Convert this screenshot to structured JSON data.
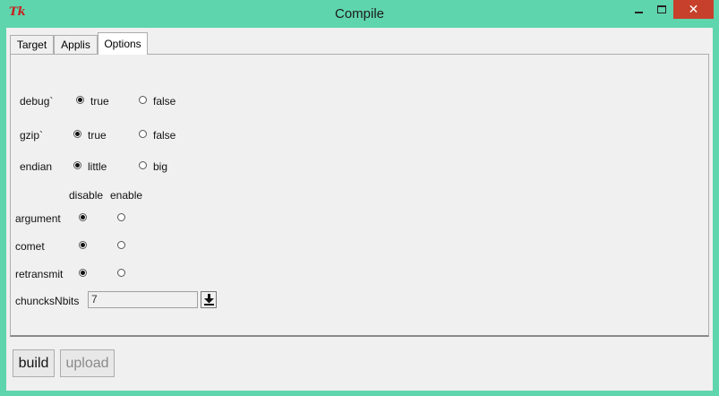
{
  "window": {
    "icon_text": "Tk",
    "title": "Compile",
    "close_glyph": "✕"
  },
  "tabs": [
    {
      "label": "Target"
    },
    {
      "label": "Applis"
    },
    {
      "label": "Options"
    }
  ],
  "options": {
    "debug": {
      "label": "debug`",
      "choices": [
        "true",
        "false"
      ],
      "selected": "true"
    },
    "gzip": {
      "label": "gzip`",
      "choices": [
        "true",
        "false"
      ],
      "selected": "true"
    },
    "endian": {
      "label": "endian",
      "choices": [
        "little",
        "big"
      ],
      "selected": "little"
    }
  },
  "matrix": {
    "columns": [
      "disable",
      "enable"
    ],
    "rows": [
      {
        "label": "argument",
        "selected": "disable"
      },
      {
        "label": "comet",
        "selected": "disable"
      },
      {
        "label": "retransmit",
        "selected": "disable"
      }
    ]
  },
  "chuncks": {
    "label": "chuncksNbits",
    "value": "7",
    "button_icon": "download-arrow-icon"
  },
  "footer": {
    "build_label": "build",
    "upload_label": "upload"
  }
}
